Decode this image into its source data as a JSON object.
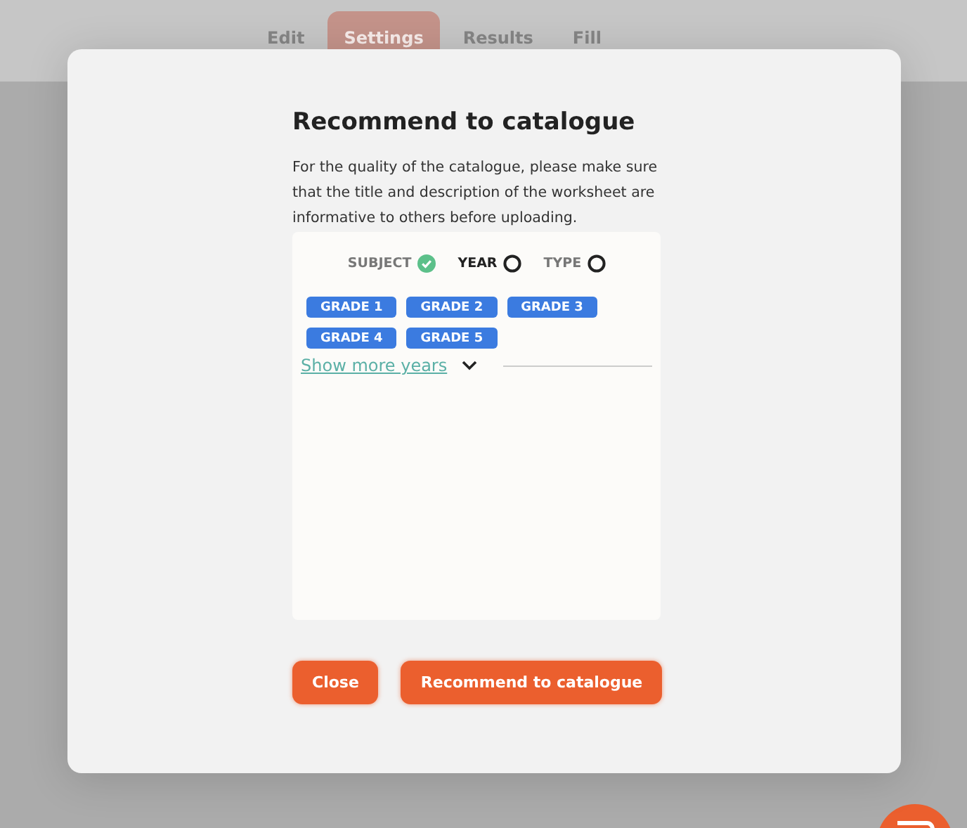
{
  "tabs": [
    {
      "label": "Edit",
      "selected": false
    },
    {
      "label": "Settings",
      "selected": true
    },
    {
      "label": "Results",
      "selected": false
    },
    {
      "label": "Fill",
      "selected": false
    }
  ],
  "dialog": {
    "title": "Recommend to catalogue",
    "description": "For the quality of the catalogue, please make sure that the title and description of the worksheet are informative to others before uploading.",
    "steps": [
      {
        "label": "SUBJECT",
        "kind": "done"
      },
      {
        "label": "YEAR",
        "kind": "current"
      },
      {
        "label": "TYPE",
        "kind": "pending"
      }
    ],
    "grades": [
      "GRADE 1",
      "GRADE 2",
      "GRADE 3",
      "GRADE 4",
      "GRADE 5"
    ],
    "show_more": {
      "label": "Show more years",
      "expanded": false
    },
    "buttons": [
      "Close",
      "Recommend to catalogue"
    ]
  }
}
